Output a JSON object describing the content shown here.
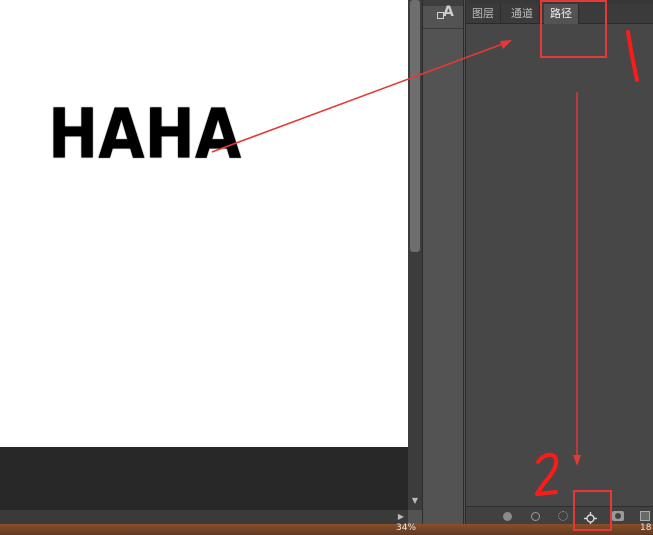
{
  "canvas": {
    "text": "HAHA"
  },
  "panel": {
    "tabs": [
      {
        "label": "图层",
        "active": false
      },
      {
        "label": "通道",
        "active": false
      },
      {
        "label": "路径",
        "active": true
      }
    ],
    "footer_icons": [
      "fill-path-icon",
      "stroke-path-icon",
      "load-selection-icon",
      "make-work-path-icon",
      "add-mask-icon",
      "new-path-icon"
    ]
  },
  "side_dock": {
    "tool_icon": "character-panel-icon",
    "tool_letter": "A"
  },
  "statusbar": {
    "zoom": "34%",
    "right": "18"
  },
  "annotations": {
    "label_1": "1",
    "label_2": "2",
    "color": "#e53935"
  }
}
